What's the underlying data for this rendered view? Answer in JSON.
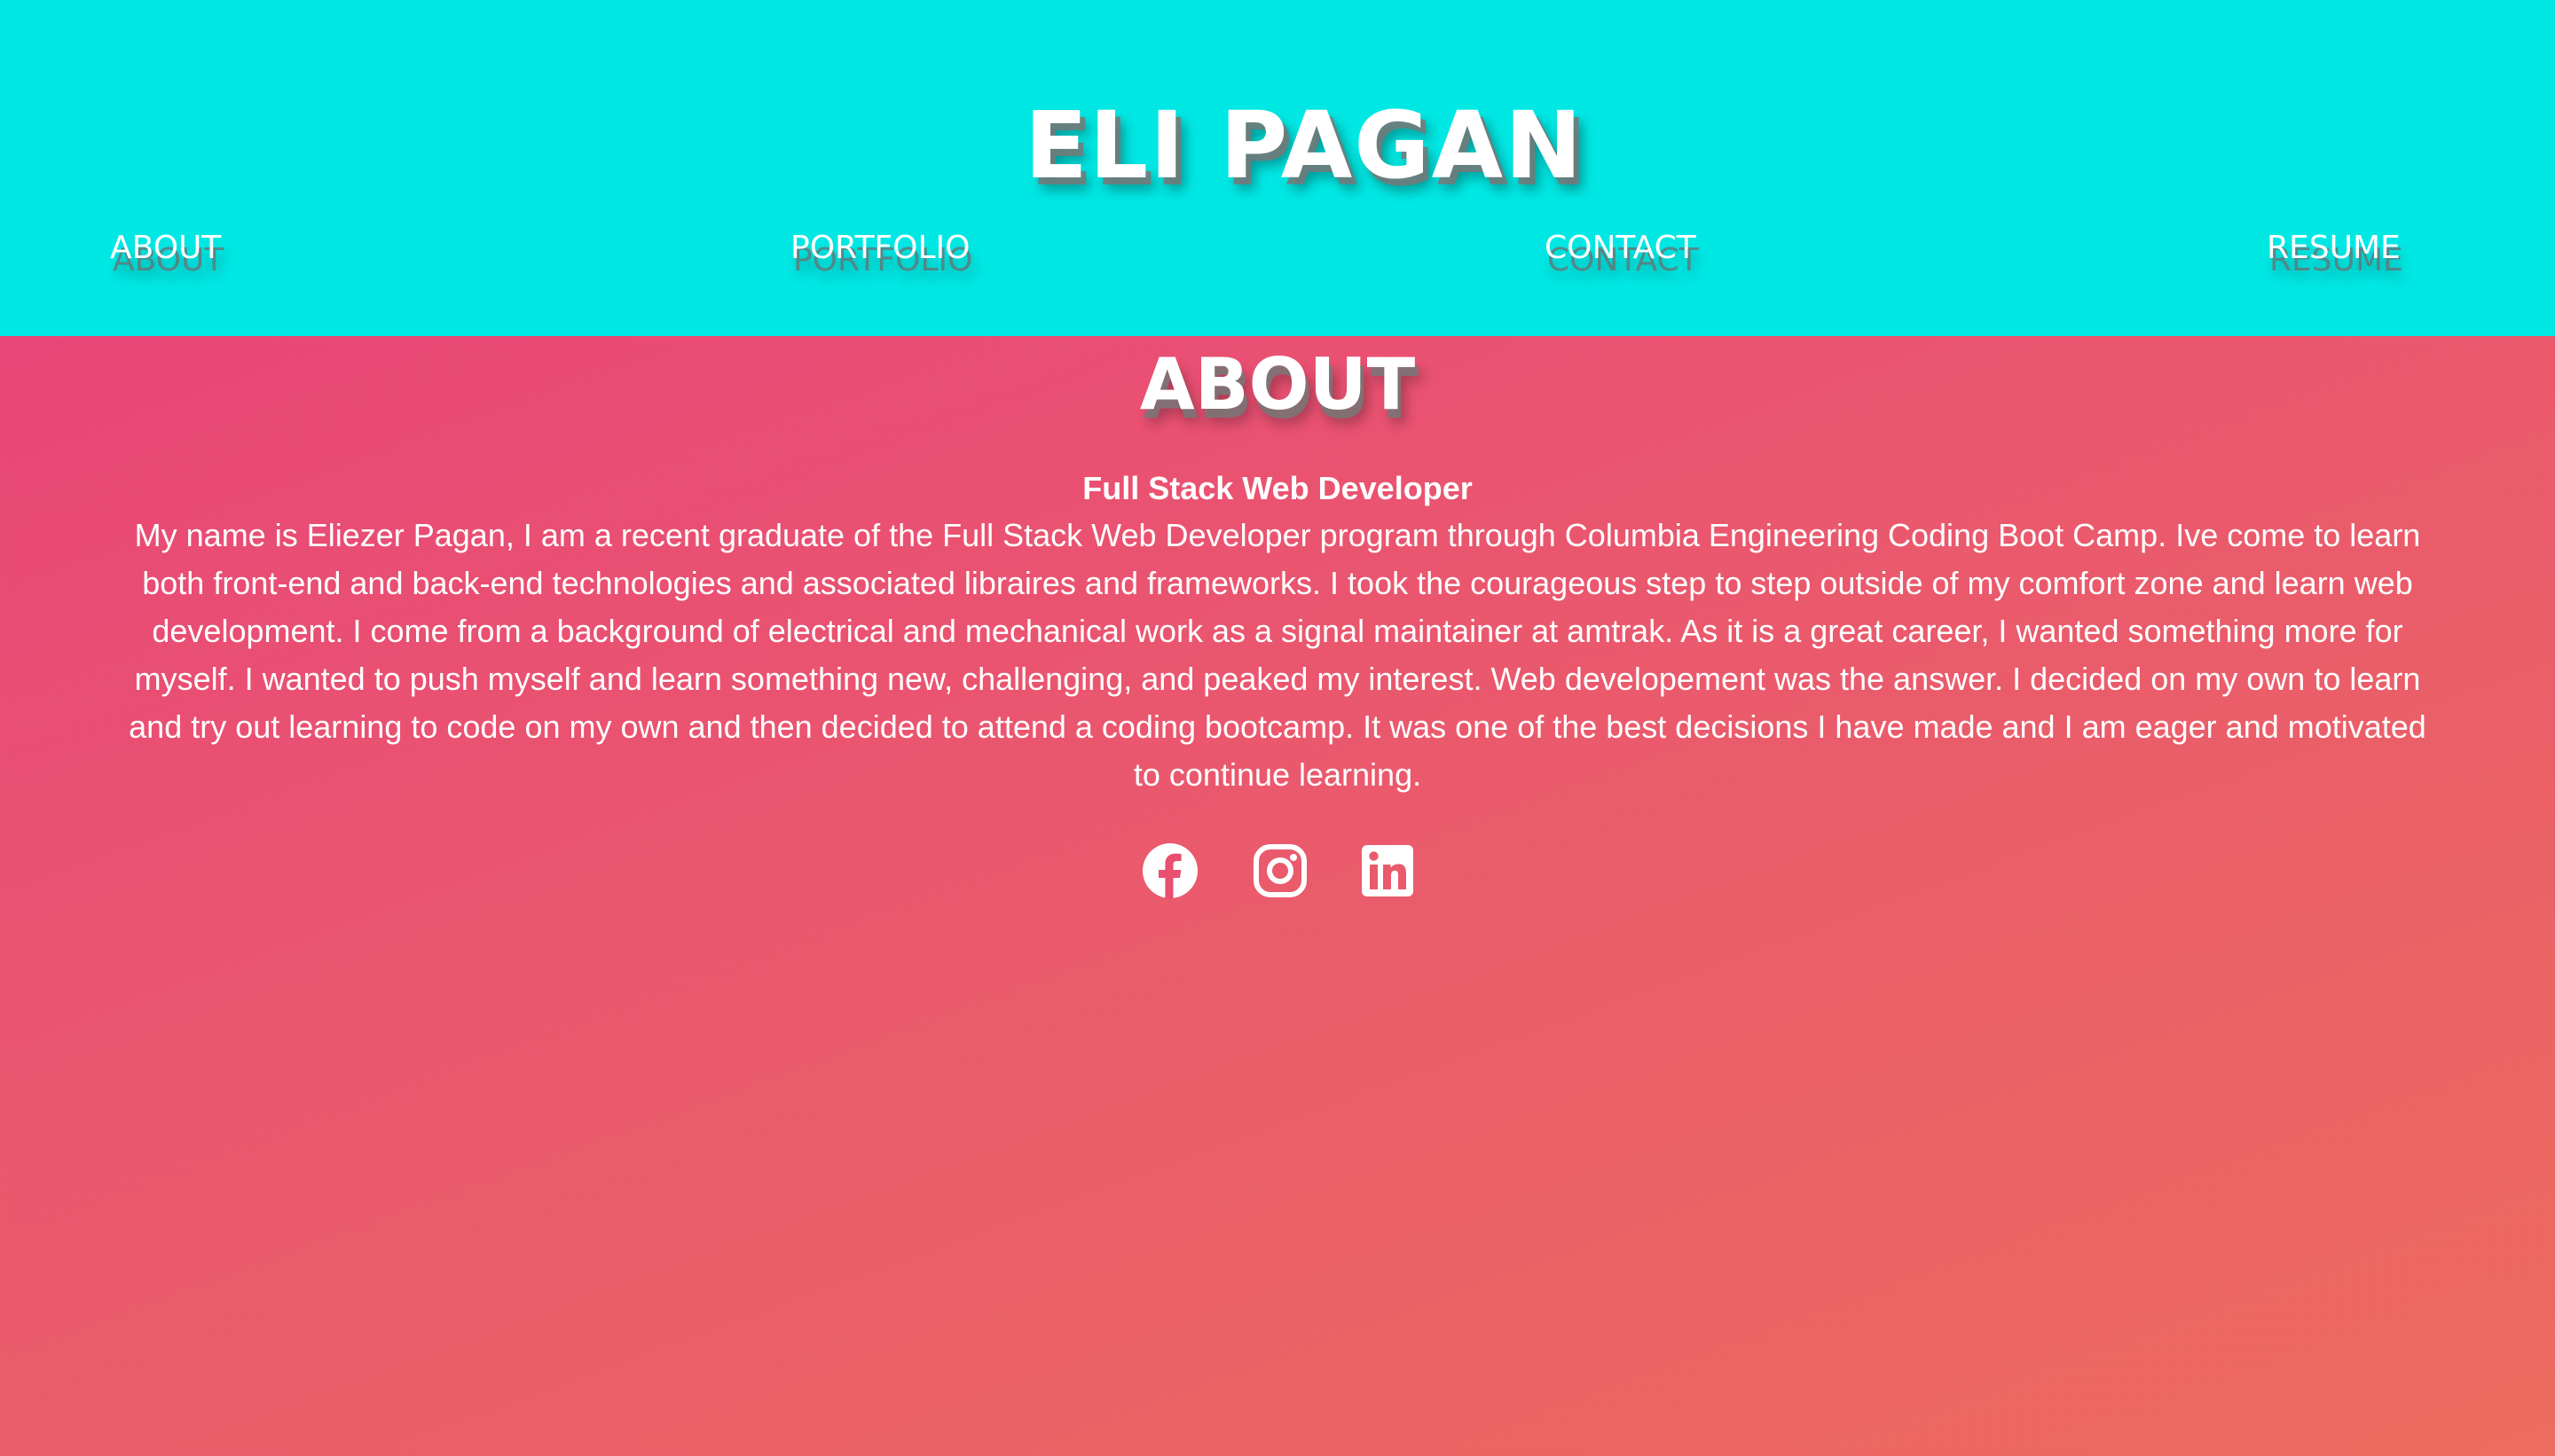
{
  "header": {
    "site_title": "ELI PAGAN",
    "background_color": "#00e8e4"
  },
  "nav": {
    "items": [
      {
        "label": "ABOUT"
      },
      {
        "label": "PORTFOLIO"
      },
      {
        "label": "CONTACT"
      },
      {
        "label": "RESUME"
      }
    ]
  },
  "about": {
    "heading": "ABOUT",
    "job_title": "Full Stack Web Developer",
    "bio": "My name is Eliezer Pagan, I am a recent graduate of the Full Stack Web Developer program through Columbia Engineering Coding Boot Camp. Ive come to learn both front-end and back-end technologies and associated libraires and frameworks. I took the courageous step to step outside of my comfort zone and learn web development. I come from a background of electrical and mechanical work as a signal maintainer at amtrak. As it is a great career, I wanted something more for myself. I wanted to push myself and learn something new, challenging, and peaked my interest. Web developement was the answer. I decided on my own to learn and try out learning to code on my own and then decided to attend a coding bootcamp. It was one of the best decisions I have made and I am eager and motivated to continue learning."
  },
  "socials": [
    {
      "icon": "facebook-icon"
    },
    {
      "icon": "instagram-icon"
    },
    {
      "icon": "linkedin-icon"
    }
  ],
  "colors": {
    "gradient_start": "#e83f7c",
    "gradient_end": "#ec6c5e",
    "text": "#ffffff"
  }
}
